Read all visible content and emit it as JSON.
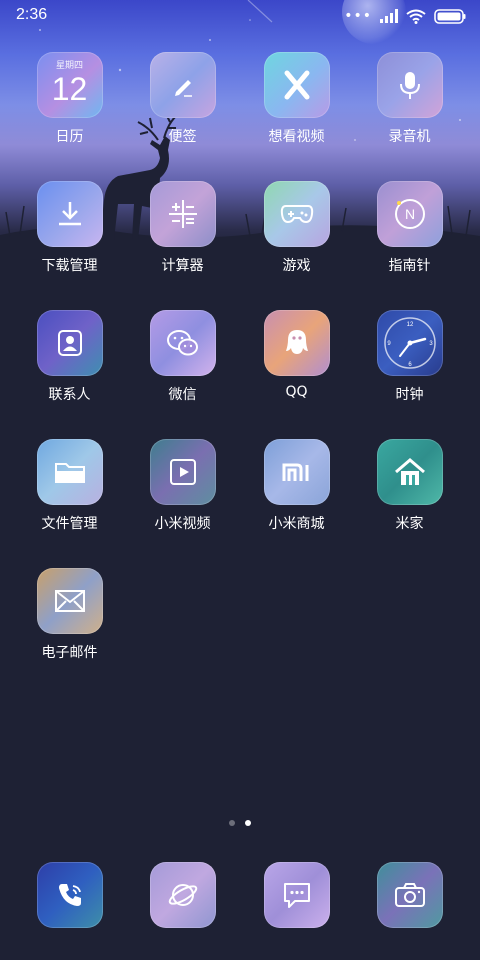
{
  "status_bar": {
    "time": "2:36",
    "icons": [
      "more-dots-icon",
      "signal-icon",
      "wifi-icon",
      "battery-icon"
    ]
  },
  "apps": [
    {
      "label": "日历",
      "icon": "calendar-icon",
      "weekday": "星期四",
      "day": "12"
    },
    {
      "label": "便签",
      "icon": "note-pen-icon"
    },
    {
      "label": "想看视频",
      "icon": "video-x-icon"
    },
    {
      "label": "录音机",
      "icon": "microphone-icon"
    },
    {
      "label": "下载管理",
      "icon": "download-icon"
    },
    {
      "label": "计算器",
      "icon": "calculator-icon"
    },
    {
      "label": "游戏",
      "icon": "gamepad-icon"
    },
    {
      "label": "指南针",
      "icon": "compass-icon"
    },
    {
      "label": "联系人",
      "icon": "contacts-icon"
    },
    {
      "label": "微信",
      "icon": "wechat-icon"
    },
    {
      "label": "QQ",
      "icon": "qq-penguin-icon"
    },
    {
      "label": "时钟",
      "icon": "clock-icon"
    },
    {
      "label": "文件管理",
      "icon": "folder-icon"
    },
    {
      "label": "小米视频",
      "icon": "play-icon"
    },
    {
      "label": "小米商城",
      "icon": "mi-logo-icon"
    },
    {
      "label": "米家",
      "icon": "home-icon"
    },
    {
      "label": "电子邮件",
      "icon": "mail-icon"
    }
  ],
  "pager": {
    "count": 2,
    "active": 2
  },
  "dock": [
    {
      "icon": "phone-icon"
    },
    {
      "icon": "browser-icon"
    },
    {
      "icon": "messages-icon"
    },
    {
      "icon": "camera-icon"
    }
  ]
}
